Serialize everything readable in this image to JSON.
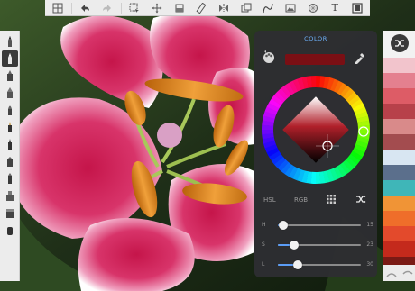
{
  "app": {
    "toolbar_icons": [
      "grid-icon",
      "undo-icon",
      "redo-icon",
      "select-icon",
      "transform-icon",
      "fill-icon",
      "ruler-icon",
      "symmetry-icon",
      "layers-icon",
      "curve-icon",
      "image-icon",
      "perspective-icon",
      "text-icon",
      "canvas-icon"
    ]
  },
  "brushes": [
    "pencil-brush",
    "pencil-brush-2",
    "marker-brush",
    "pen-brush",
    "brush-tip",
    "ink-brush",
    "ink-brush-2",
    "airbrush",
    "chisel-marker",
    "stamp-brush",
    "eraser-brush",
    "smudge-brush"
  ],
  "color_panel": {
    "title": "COLOR",
    "current_color": "#7a0f14",
    "modes": [
      "HSL",
      "RGB"
    ],
    "active_mode": "HSL",
    "sliders": [
      {
        "label": "H",
        "value": "15",
        "fraction": 0.07
      },
      {
        "label": "S",
        "value": "23",
        "fraction": 0.2
      },
      {
        "label": "L",
        "value": "30",
        "fraction": 0.24
      }
    ]
  },
  "swatches": {
    "colors": [
      "#f2c4cc",
      "#e4808f",
      "#dd5c66",
      "#b7414a",
      "#d98a8a",
      "#a34c4f",
      "#d8e6f2",
      "#5b6f8c",
      "#3fb6b8",
      "#f09436",
      "#ef6e2a",
      "#e34a2c",
      "#c42a1c",
      "#7a1a15"
    ]
  },
  "colors": {
    "accent": "#5b9cf5",
    "title_blue": "#6fb4ff",
    "panel_bg": "#2e2e32",
    "toolbar_bg": "#ececec"
  }
}
